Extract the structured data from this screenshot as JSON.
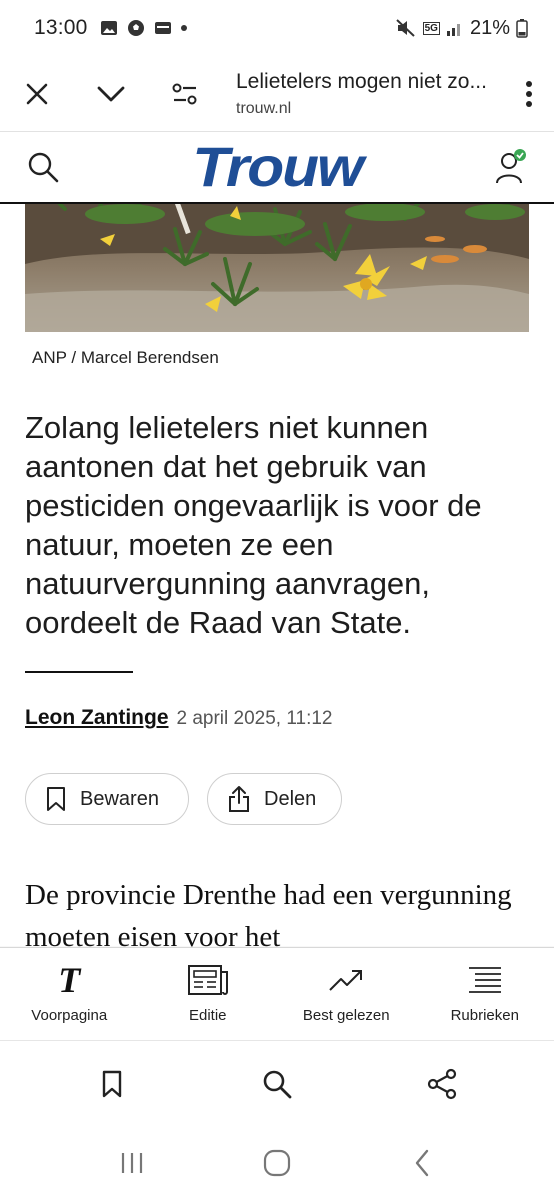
{
  "status_bar": {
    "time": "13:00",
    "battery": "21%",
    "network": "5G",
    "icons": [
      "gallery-icon",
      "soccer-icon",
      "wallet-icon",
      "dot-icon",
      "mute-icon",
      "signal-icon",
      "battery-icon"
    ]
  },
  "browser": {
    "tab_title": "Lelietelers mogen niet zo...",
    "url": "trouw.nl",
    "icons": [
      "close-icon",
      "chevron-down-icon",
      "page-settings-icon",
      "more-vert-icon"
    ]
  },
  "site_header": {
    "logo": "Trouw",
    "logo_color": "#1f4e96",
    "icons": [
      "search-icon",
      "account-icon"
    ]
  },
  "article": {
    "image_credit": "ANP / Marcel Berendsen",
    "lead": "Zolang lelietelers niet kunnen aantonen dat het gebruik van pesticiden ongevaarlijk is voor de natuur, moeten ze een natuurvergunning aanvragen, oordeelt de Raad van State.",
    "author": "Leon Zantinge",
    "date": "2 april 2025, 11:12",
    "save_label": "Bewaren",
    "share_label": "Delen",
    "body_start": "De provincie Drenthe had een vergunning moeten eisen voor het"
  },
  "site_nav": {
    "items": [
      {
        "label": "Voorpagina",
        "icon": "trouw-t-icon"
      },
      {
        "label": "Editie",
        "icon": "newspaper-icon"
      },
      {
        "label": "Best gelezen",
        "icon": "trending-icon"
      },
      {
        "label": "Rubrieken",
        "icon": "list-icon"
      }
    ]
  },
  "browser_bottom": {
    "icons": [
      "bookmark-icon",
      "search-icon",
      "share-icon"
    ]
  },
  "android_nav": {
    "icons": [
      "recents-icon",
      "home-icon",
      "back-icon"
    ]
  }
}
